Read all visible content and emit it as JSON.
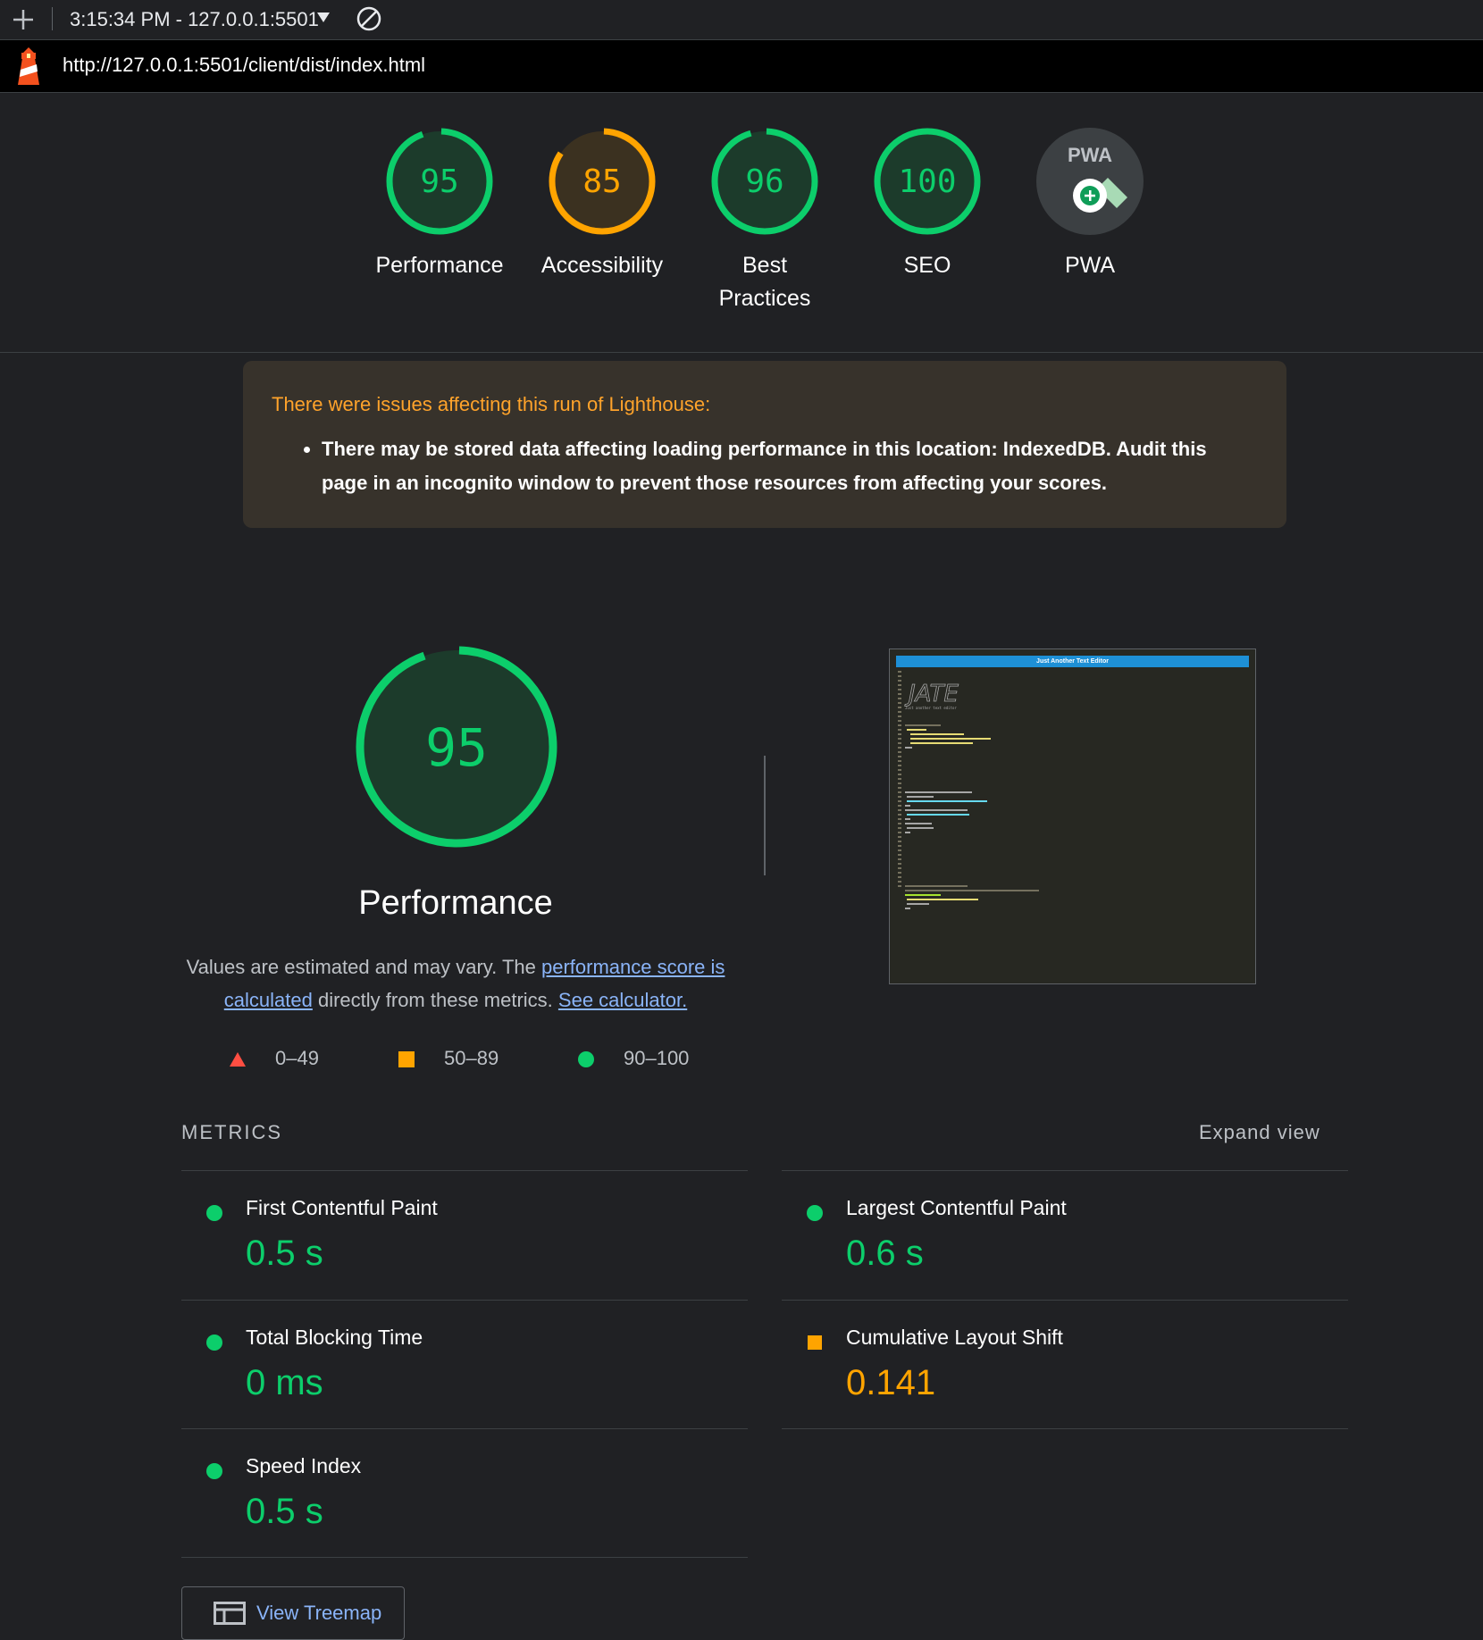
{
  "toolbar": {
    "time_host": "3:15:34 PM - 127.0.0.1:5501",
    "icons": [
      "plus-icon",
      "dropdown-caret-icon",
      "clear-block-icon"
    ]
  },
  "urlbar": {
    "url": "http://127.0.0.1:5501/client/dist/index.html",
    "logo": "lighthouse-logo"
  },
  "gauges": [
    {
      "label": "Performance",
      "score": "95",
      "value": 95,
      "rating": "pass"
    },
    {
      "label": "Accessibility",
      "score": "85",
      "value": 85,
      "rating": "average"
    },
    {
      "label": "Best",
      "label2": "Practices",
      "score": "96",
      "value": 96,
      "rating": "pass"
    },
    {
      "label": "SEO",
      "score": "100",
      "value": 100,
      "rating": "pass"
    },
    {
      "label": "PWA",
      "badge": "PWA",
      "rating": "na"
    }
  ],
  "warning": {
    "title": "There were issues affecting this run of Lighthouse:",
    "items": [
      "There may be stored data affecting loading performance in this location: IndexedDB. Audit this page in an incognito window to prevent those resources from affecting your scores."
    ]
  },
  "performance": {
    "score": "95",
    "value": 95,
    "title": "Performance",
    "desc_pre": "Values are estimated and may vary. The ",
    "desc_link1": "performance score is calculated",
    "desc_mid": " directly from these metrics. ",
    "desc_link2": "See calculator."
  },
  "legend": [
    {
      "range": "0–49",
      "shape": "triangle",
      "color": "#ff4e42"
    },
    {
      "range": "50–89",
      "shape": "square",
      "color": "#ffa400"
    },
    {
      "range": "90–100",
      "shape": "circle",
      "color": "#0cce6b"
    }
  ],
  "screenshot": {
    "title": "Just Another Text Editor",
    "logo": "JATE",
    "subtitle": "Just another text editor"
  },
  "metrics": {
    "title": "METRICS",
    "expand": "Expand view",
    "items": [
      {
        "name": "First Contentful Paint",
        "value": "0.5 s",
        "rating": "good"
      },
      {
        "name": "Largest Contentful Paint",
        "value": "0.6 s",
        "rating": "good"
      },
      {
        "name": "Total Blocking Time",
        "value": "0 ms",
        "rating": "good"
      },
      {
        "name": "Cumulative Layout Shift",
        "value": "0.141",
        "rating": "average"
      },
      {
        "name": "Speed Index",
        "value": "0.5 s",
        "rating": "good"
      }
    ]
  },
  "treemap": {
    "label": "View Treemap"
  },
  "colors": {
    "pass": "#0cce6b",
    "average": "#ffa400",
    "fail": "#ff4e42",
    "link": "#8ab4f8"
  }
}
